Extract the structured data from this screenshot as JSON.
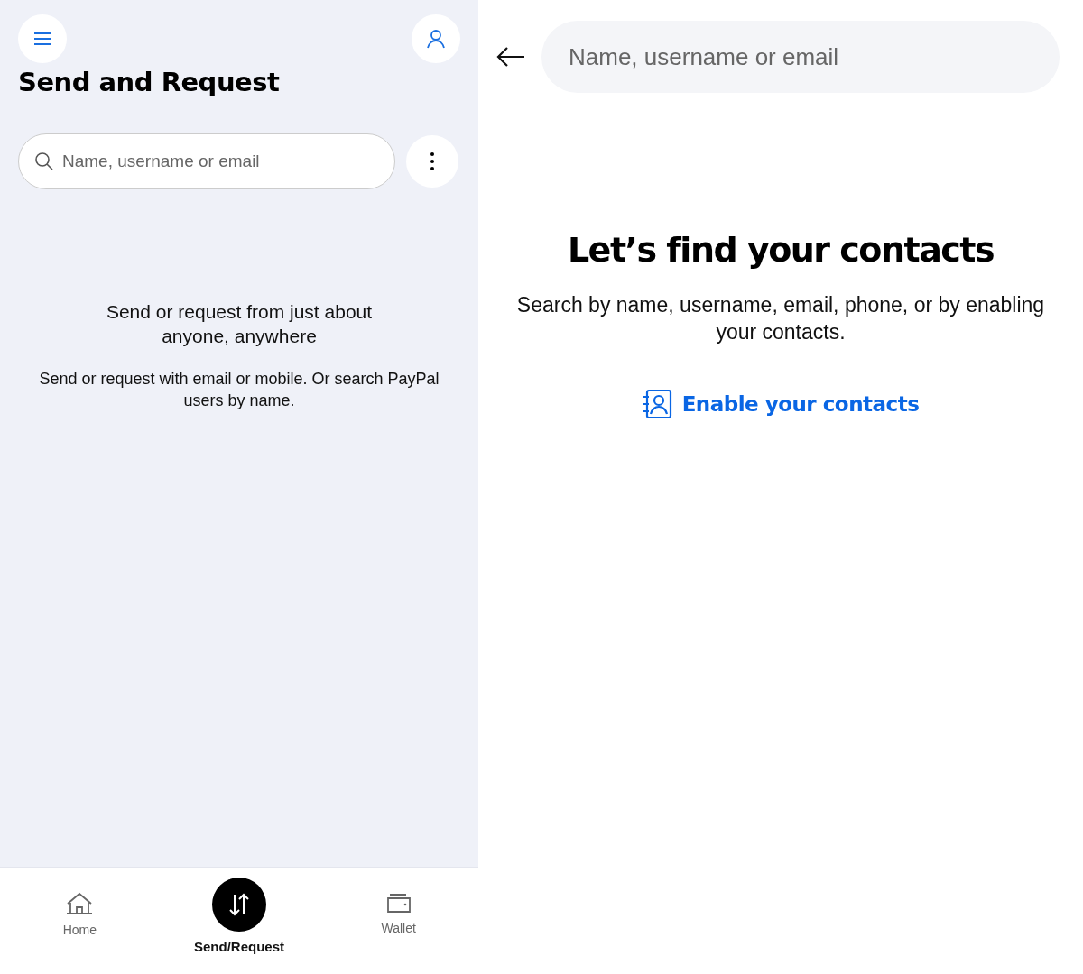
{
  "send_screen": {
    "title": "Send and Request",
    "search": {
      "placeholder": "Name, username or email"
    },
    "empty_heading": "Send or request from just about anyone, anywhere",
    "empty_text": "Send or request with email or mobile. Or search PayPal users by name."
  },
  "bottom_nav": [
    {
      "kind": "home",
      "label": "Home",
      "selected": false
    },
    {
      "kind": "transfer",
      "label": "Send/Request",
      "selected": true
    },
    {
      "kind": "wallet",
      "label": "Wallet",
      "selected": false
    }
  ],
  "search_screen": {
    "search": {
      "placeholder": "Name, username or email"
    },
    "heading": "Let’s find your contacts",
    "text": "Search by name, username, email, phone, or by enabling your contacts.",
    "link": "Enable your contacts"
  }
}
